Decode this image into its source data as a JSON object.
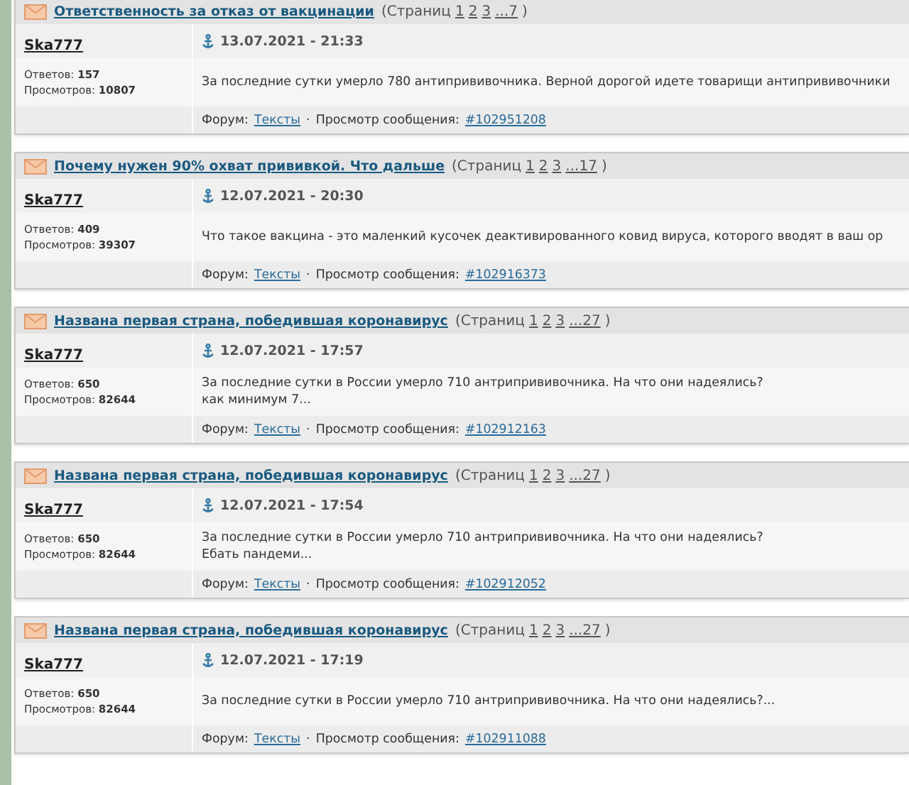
{
  "separator": "·",
  "posts": [
    {
      "topic": "Ответственность за отказ от вакцинации",
      "pages_label": "(Страниц",
      "pages": [
        "1",
        "2",
        "3",
        "...7"
      ],
      "pages_close": ")",
      "author": "Ska777",
      "date": "13.07.2021 - 21:33",
      "replies_label": "Ответов:",
      "replies": "157",
      "views_label": "Просмотров:",
      "views": "10807",
      "body": [
        "За последние сутки умерло 780 антипрививочника. Верной дорогой идете товарищи антипрививочники"
      ],
      "forum_label": "Форум:",
      "forum": "Тексты",
      "view_label": "Просмотр сообщения:",
      "post_link": "#102951208"
    },
    {
      "topic": "Почему нужен 90% охват прививкой. Что дальше",
      "pages_label": "(Страниц",
      "pages": [
        "1",
        "2",
        "3",
        "...17"
      ],
      "pages_close": ")",
      "author": "Ska777",
      "date": "12.07.2021 - 20:30",
      "replies_label": "Ответов:",
      "replies": "409",
      "views_label": "Просмотров:",
      "views": "39307",
      "body": [
        "Что такое вакцина - это маленкий кусочек деактивированного ковид вируса, которого вводят в ваш ор"
      ],
      "forum_label": "Форум:",
      "forum": "Тексты",
      "view_label": "Просмотр сообщения:",
      "post_link": "#102916373"
    },
    {
      "topic": "Названа первая страна, победившая коронавирус",
      "pages_label": "(Страниц",
      "pages": [
        "1",
        "2",
        "3",
        "...27"
      ],
      "pages_close": ")",
      "author": "Ska777",
      "date": "12.07.2021 - 17:57",
      "replies_label": "Ответов:",
      "replies": "650",
      "views_label": "Просмотров:",
      "views": "82644",
      "body": [
        "За последние сутки в России умерло 710 антрипрививочника.  На что они надеялись?",
        "как минимум 7..."
      ],
      "forum_label": "Форум:",
      "forum": "Тексты",
      "view_label": "Просмотр сообщения:",
      "post_link": "#102912163"
    },
    {
      "topic": "Названа первая страна, победившая коронавирус",
      "pages_label": "(Страниц",
      "pages": [
        "1",
        "2",
        "3",
        "...27"
      ],
      "pages_close": ")",
      "author": "Ska777",
      "date": "12.07.2021 - 17:54",
      "replies_label": "Ответов:",
      "replies": "650",
      "views_label": "Просмотров:",
      "views": "82644",
      "body": [
        "За последние сутки в России умерло 710 антрипрививочника.  На что они надеялись?",
        "Ебать пандеми..."
      ],
      "forum_label": "Форум:",
      "forum": "Тексты",
      "view_label": "Просмотр сообщения:",
      "post_link": "#102912052"
    },
    {
      "topic": "Названа первая страна, победившая коронавирус",
      "pages_label": "(Страниц",
      "pages": [
        "1",
        "2",
        "3",
        "...27"
      ],
      "pages_close": ")",
      "author": "Ska777",
      "date": "12.07.2021 - 17:19",
      "replies_label": "Ответов:",
      "replies": "650",
      "views_label": "Просмотров:",
      "views": "82644",
      "body": [
        "За последние сутки в России умерло 710 антрипрививочника. На что они надеялись?..."
      ],
      "forum_label": "Форум:",
      "forum": "Тексты",
      "view_label": "Просмотр сообщения:",
      "post_link": "#102911088"
    }
  ]
}
